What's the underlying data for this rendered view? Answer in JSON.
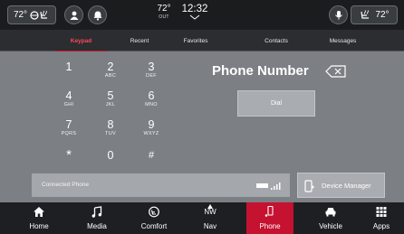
{
  "colors": {
    "accent": "#c41230",
    "active_tab_text": "#ff4757",
    "panel": "#7c8085",
    "button": "#a9acb0"
  },
  "status_bar": {
    "left_temp": "72°",
    "left_icon": "heated-seat-steering-icon",
    "driver_icon": "driver-icon",
    "alert_icon": "bell-icon",
    "outside_temp": "72°",
    "outside_label": "OUT",
    "time": "12:32",
    "mic_icon": "microphone-icon",
    "right_icon": "seat-heat-icon",
    "right_temp": "72°"
  },
  "tabs": [
    {
      "label": "Keypad",
      "active": true
    },
    {
      "label": "Recent",
      "active": false
    },
    {
      "label": "Favorites",
      "active": false
    },
    {
      "label": "Contacts",
      "active": false
    },
    {
      "label": "Messages",
      "active": false
    }
  ],
  "keypad": {
    "keys": [
      {
        "digit": "1",
        "letters": ""
      },
      {
        "digit": "2",
        "letters": "ABC"
      },
      {
        "digit": "3",
        "letters": "DEF"
      },
      {
        "digit": "4",
        "letters": "GHI"
      },
      {
        "digit": "5",
        "letters": "JKL"
      },
      {
        "digit": "6",
        "letters": "MNO"
      },
      {
        "digit": "7",
        "letters": "PQRS"
      },
      {
        "digit": "8",
        "letters": "TUV"
      },
      {
        "digit": "9",
        "letters": "WXYZ"
      },
      {
        "digit": "*",
        "letters": ""
      },
      {
        "digit": "0",
        "letters": ""
      },
      {
        "digit": "#",
        "letters": ""
      }
    ]
  },
  "phone": {
    "number_placeholder": "Phone Number",
    "dial_label": "Dial",
    "connected_label": "Connected Phone",
    "device_manager_label": "Device Manager"
  },
  "nav": [
    {
      "label": "Home",
      "icon": "home-icon",
      "active": false
    },
    {
      "label": "Media",
      "icon": "music-note-icon",
      "active": false
    },
    {
      "label": "Comfort",
      "icon": "comfort-icon",
      "active": false
    },
    {
      "label": "Nav",
      "icon": "compass-icon",
      "heading": "NW",
      "active": false
    },
    {
      "label": "Phone",
      "icon": "phone-icon",
      "active": true
    },
    {
      "label": "Vehicle",
      "icon": "car-icon",
      "active": false
    },
    {
      "label": "Apps",
      "icon": "apps-grid-icon",
      "active": false
    }
  ]
}
